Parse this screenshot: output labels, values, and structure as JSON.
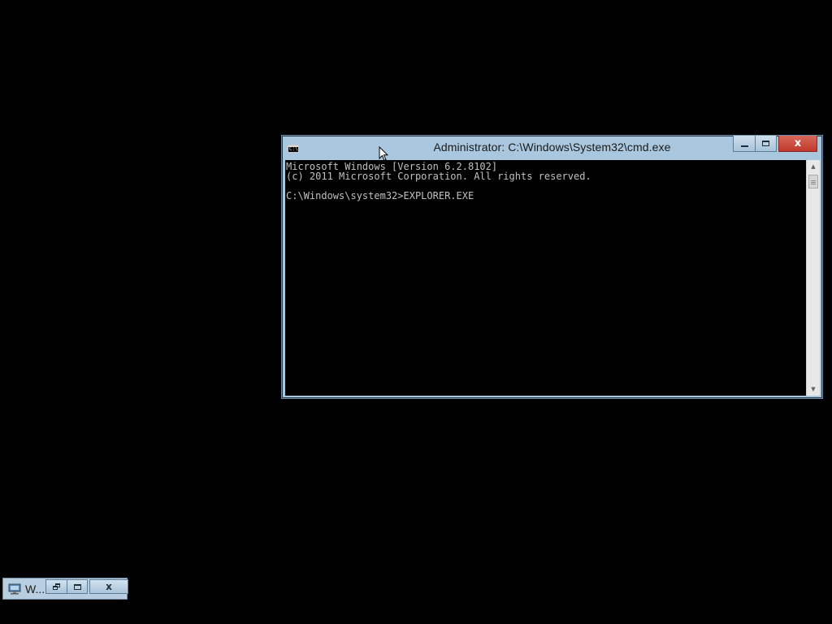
{
  "cmd_window": {
    "title": "Administrator: C:\\Windows\\System32\\cmd.exe",
    "icon": "console-icon",
    "icon_glyph": "C:\\",
    "buttons": {
      "minimize": "minimize-icon",
      "maximize": "maximize-icon",
      "close_label": "x"
    },
    "console_lines": [
      "Microsoft Windows [Version 6.2.8102]",
      "(c) 2011 Microsoft Corporation. All rights reserved.",
      "",
      "C:\\Windows\\system32>EXPLORER.EXE"
    ],
    "scrollbar": {
      "up": "▲",
      "down": "▼"
    }
  },
  "minimized_window": {
    "title": "W...",
    "icon": "computer-icon",
    "close_label": "x"
  },
  "colors": {
    "desktop": "#000000",
    "console_bg": "#000000",
    "console_text": "#c0c0c0",
    "window_frame": "#a9c7df",
    "close_button": "#c1392b"
  }
}
